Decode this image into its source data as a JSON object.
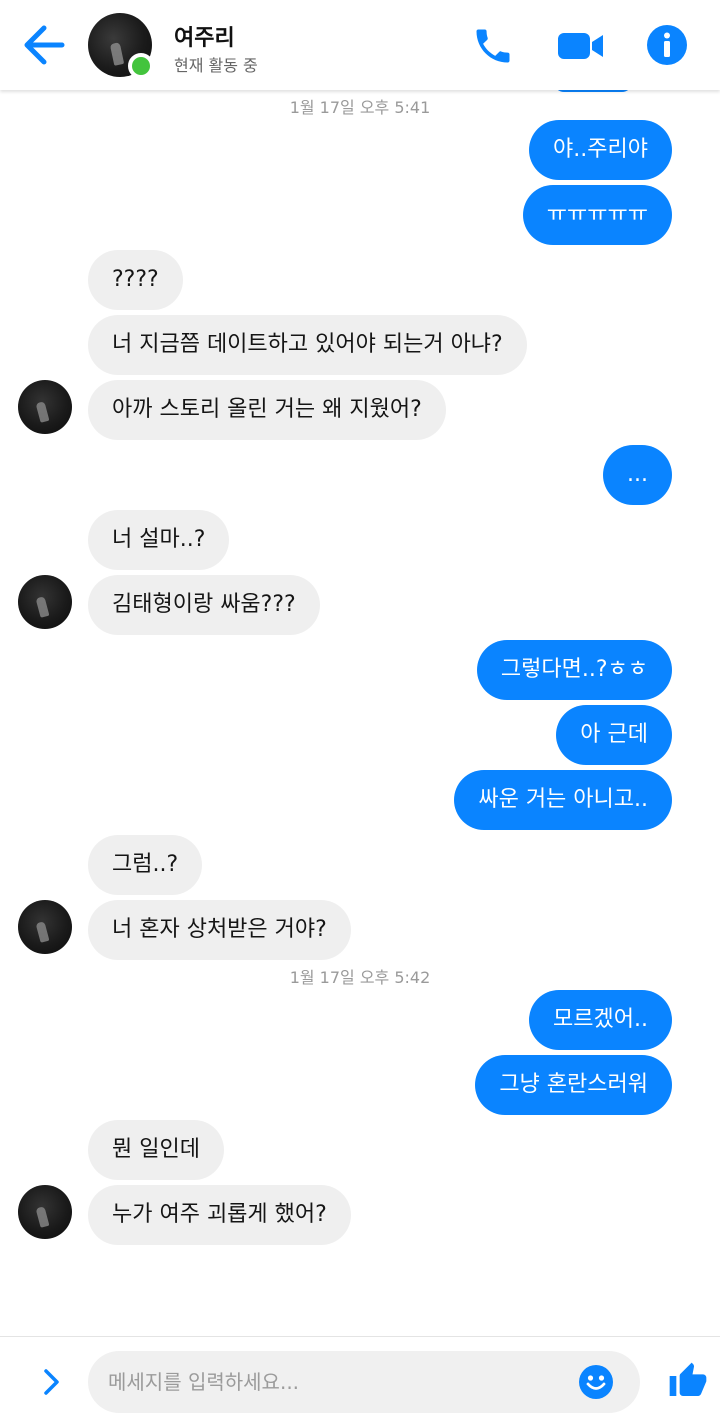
{
  "header": {
    "contact_name": "여주리",
    "status": "현재 활동 중",
    "icons": [
      "back-arrow-icon",
      "phone-icon",
      "video-camera-icon",
      "info-icon"
    ]
  },
  "timestamps": [
    "1월 17일 오후 5:41",
    "1월 17일 오후 5:42"
  ],
  "messages": [
    {
      "from": "me",
      "text": "야..주리야"
    },
    {
      "from": "me",
      "text": "ㅠㅠㅠㅠㅠ"
    },
    {
      "from": "them",
      "text": "????"
    },
    {
      "from": "them",
      "text": "너 지금쯤 데이트하고 있어야 되는거 아냐?"
    },
    {
      "from": "them",
      "text": "아까 스토리 올린 거는 왜 지웠어?"
    },
    {
      "from": "me",
      "text": "..."
    },
    {
      "from": "them",
      "text": "너 설마..?"
    },
    {
      "from": "them",
      "text": "김태형이랑 싸움???"
    },
    {
      "from": "me",
      "text": "그렇다면..?ㅎㅎ"
    },
    {
      "from": "me",
      "text": "아 근데"
    },
    {
      "from": "me",
      "text": "싸운 거는 아니고.."
    },
    {
      "from": "them",
      "text": "그럼..?"
    },
    {
      "from": "them",
      "text": "너 혼자 상처받은 거야?"
    },
    {
      "from": "me",
      "text": "모르겠어.."
    },
    {
      "from": "me",
      "text": "그냥 혼란스러워"
    },
    {
      "from": "them",
      "text": "뭔 일인데"
    },
    {
      "from": "them",
      "text": "누가 여주 괴롭게 했어?"
    }
  ],
  "composer": {
    "placeholder": "메세지를 입력하세요...",
    "value": ""
  },
  "colors": {
    "accent": "#0a84ff",
    "incoming_bubble": "#efefef",
    "online": "#43c43d"
  }
}
